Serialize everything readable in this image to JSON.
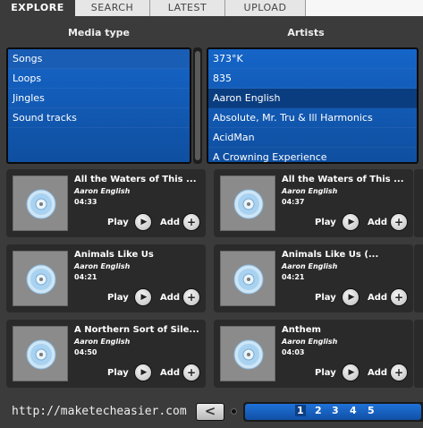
{
  "tabs": [
    "EXPLORE",
    "SEARCH",
    "LATEST",
    "UPLOAD"
  ],
  "columns": {
    "media_type": "Media type",
    "artists": "Artists"
  },
  "media_types": [
    "Songs",
    "Loops",
    "Jingles",
    "Sound tracks"
  ],
  "artists": [
    "373°K",
    "835",
    "Aaron English",
    "Absolute, Mr. Tru & Ill Harmonics",
    "AcidMan",
    "A Crowning Experience"
  ],
  "songs": [
    {
      "title": "All the Waters of This ...",
      "artist": "Aaron English",
      "duration": "04:33"
    },
    {
      "title": "All the Waters of This ...",
      "artist": "Aaron English",
      "duration": "04:37"
    },
    {
      "title": "Animals Like Us",
      "artist": "Aaron English",
      "duration": "04:21"
    },
    {
      "title": "Animals Like Us (...",
      "artist": "Aaron English",
      "duration": "04:21"
    },
    {
      "title": "A Northern Sort of Sile...",
      "artist": "Aaron English",
      "duration": "04:50"
    },
    {
      "title": "Anthem",
      "artist": "Aaron English",
      "duration": "04:03"
    }
  ],
  "actions": {
    "play": "Play",
    "add": "Add"
  },
  "footer": {
    "url": "http://maketecheasier.com",
    "prev": "<",
    "pages": [
      "1",
      "2",
      "3",
      "4",
      "5"
    ]
  },
  "colors": {
    "accent": "#1565c8",
    "selected": "#0a3d80",
    "card": "#2a2a2a"
  }
}
